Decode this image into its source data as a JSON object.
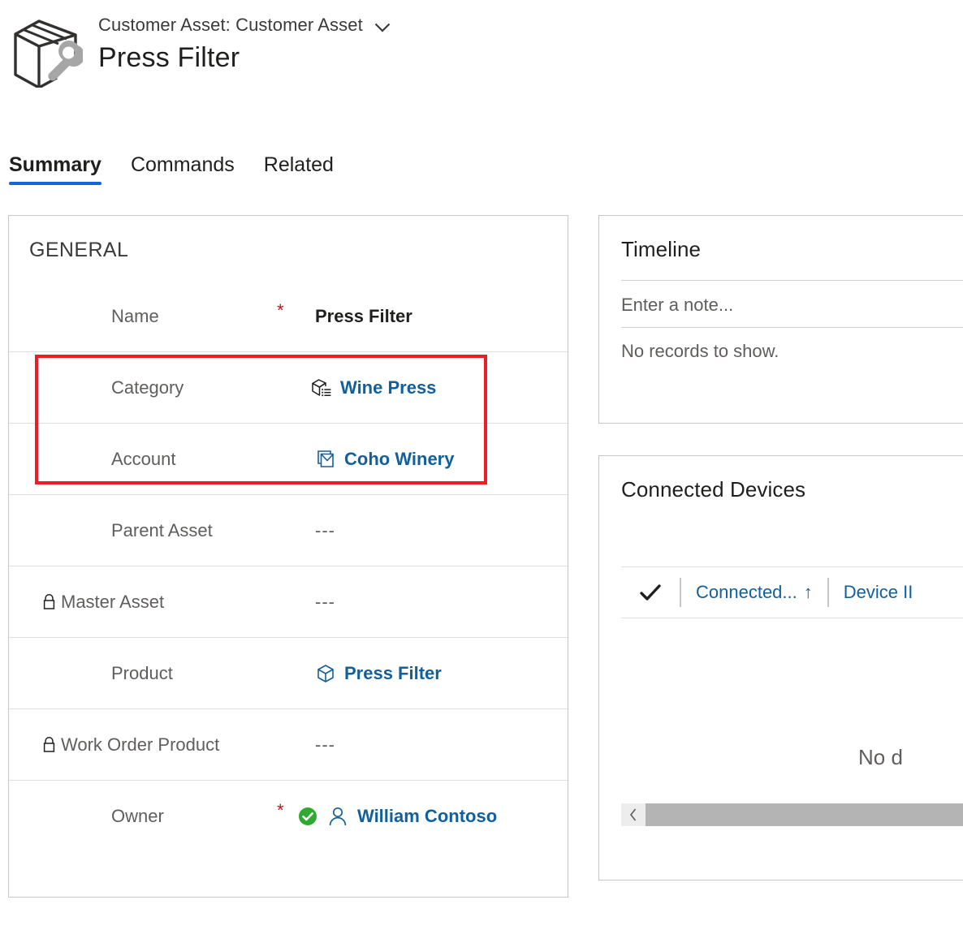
{
  "header": {
    "asset_icon": "package-wrench-icon",
    "entity_label": "Customer Asset: Customer Asset",
    "dropdown_icon": "chevron-down-icon",
    "record_title": "Press Filter"
  },
  "tabs": [
    {
      "label": "Summary",
      "active": true
    },
    {
      "label": "Commands",
      "active": false
    },
    {
      "label": "Related",
      "active": false
    }
  ],
  "general": {
    "section_title": "GENERAL",
    "fields": [
      {
        "label": "Name",
        "locked": false,
        "required": true,
        "value": "Press Filter",
        "kind": "text",
        "icon": null
      },
      {
        "label": "Category",
        "locked": false,
        "required": false,
        "value": "Wine Press",
        "kind": "link",
        "icon": "category-box-list-icon"
      },
      {
        "label": "Account",
        "locked": false,
        "required": false,
        "value": "Coho Winery",
        "kind": "link",
        "icon": "account-icon"
      },
      {
        "label": "Parent Asset",
        "locked": false,
        "required": false,
        "value": "---",
        "kind": "empty",
        "icon": null
      },
      {
        "label": "Master Asset",
        "locked": true,
        "required": false,
        "value": "---",
        "kind": "empty",
        "icon": "lock-icon"
      },
      {
        "label": "Product",
        "locked": false,
        "required": false,
        "value": "Press Filter",
        "kind": "link",
        "icon": "product-box-icon"
      },
      {
        "label": "Work Order Product",
        "locked": true,
        "required": false,
        "value": "---",
        "kind": "empty",
        "icon": "lock-icon"
      },
      {
        "label": "Owner",
        "locked": false,
        "required": true,
        "value": "William Contoso",
        "kind": "link",
        "icon": "user-icon",
        "status_icon": "green-check-circle-icon"
      }
    ]
  },
  "highlight": {
    "annotation_color": "#ee1c25",
    "covers_fields": [
      "Category",
      "Account"
    ]
  },
  "timeline": {
    "title": "Timeline",
    "note_placeholder": "Enter a note...",
    "empty_text": "No records to show."
  },
  "connected_devices": {
    "title": "Connected Devices",
    "select_all_icon": "checkmark-icon",
    "columns": [
      {
        "label": "Connected...",
        "sort_icon": "arrow-up-icon",
        "sorted": "ascending"
      },
      {
        "label": "Device II",
        "sort_icon": null,
        "sorted": null
      }
    ],
    "empty_text": "No d",
    "scroll_left_icon": "chevron-left-icon"
  },
  "colors": {
    "link_blue": "#12609b",
    "accent_blue": "#1267d8",
    "required_red": "#c0161c",
    "annotation_red": "#ee1c25",
    "status_green": "#2eab2e",
    "label_gray": "#605e5c",
    "border_gray": "#c8c6c4",
    "divider_gray": "#e1dfdd",
    "scrollbar_gray": "#b4b4b4"
  }
}
